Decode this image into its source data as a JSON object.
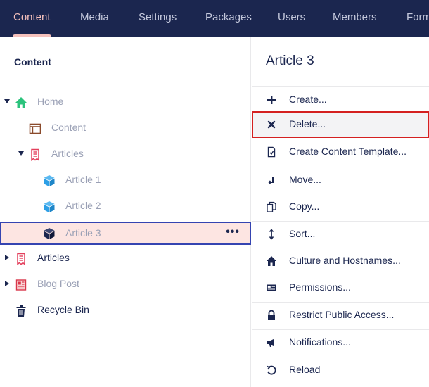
{
  "nav": {
    "tabs": [
      {
        "label": "Content",
        "active": true
      },
      {
        "label": "Media"
      },
      {
        "label": "Settings"
      },
      {
        "label": "Packages"
      },
      {
        "label": "Users"
      },
      {
        "label": "Members"
      },
      {
        "label": "Forms"
      }
    ]
  },
  "tree": {
    "title": "Content",
    "nodes": [
      {
        "label": "Home",
        "icon": "home-icon",
        "expanded": true
      },
      {
        "label": "Content",
        "icon": "window-icon"
      },
      {
        "label": "Articles",
        "icon": "article-list-icon",
        "expanded": true
      },
      {
        "label": "Article 1",
        "icon": "cube-icon"
      },
      {
        "label": "Article 2",
        "icon": "cube-icon"
      },
      {
        "label": "Article 3",
        "icon": "cube-icon",
        "selected": true,
        "more": "•••"
      },
      {
        "label": "Articles",
        "icon": "article-list-icon",
        "expanded": false
      },
      {
        "label": "Blog Post",
        "icon": "blog-icon",
        "expanded": false
      },
      {
        "label": "Recycle Bin",
        "icon": "trash-icon"
      }
    ]
  },
  "actions": {
    "title": "Article 3",
    "items": [
      {
        "label": "Create...",
        "icon": "plus-icon"
      },
      {
        "label": "Delete...",
        "icon": "delete-x-icon",
        "highlighted": true
      },
      {
        "label": "Create Content Template...",
        "icon": "document-template-icon"
      },
      {
        "label": "Move...",
        "icon": "move-icon"
      },
      {
        "label": "Copy...",
        "icon": "copy-icon"
      },
      {
        "label": "Sort...",
        "icon": "sort-icon"
      },
      {
        "label": "Culture and Hostnames...",
        "icon": "home-icon"
      },
      {
        "label": "Permissions...",
        "icon": "permissions-icon"
      },
      {
        "label": "Restrict Public Access...",
        "icon": "lock-icon"
      },
      {
        "label": "Notifications...",
        "icon": "megaphone-icon"
      },
      {
        "label": "Reload",
        "icon": "reload-icon"
      }
    ]
  },
  "colors": {
    "nav_bg": "#1b264f",
    "nav_active": "#f5c1bc",
    "selected_bg": "#fde5e2",
    "selected_border": "#3544b1",
    "highlight_border": "#d42020",
    "home_icon": "#2bc37c",
    "cube_icon": "#2d9fe6",
    "article_icon": "#e3405d"
  }
}
